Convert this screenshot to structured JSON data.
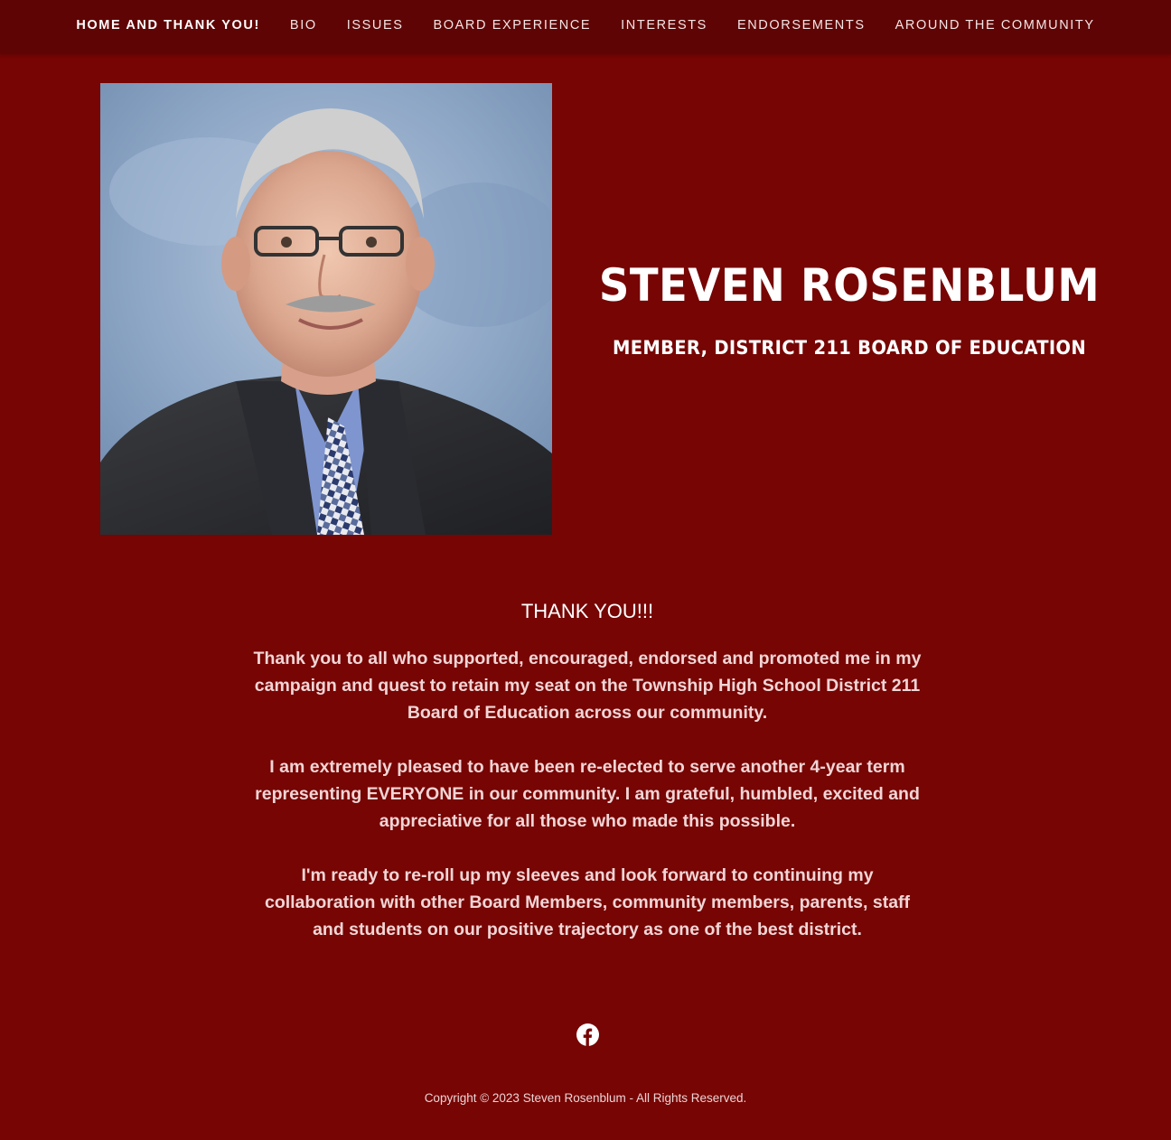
{
  "nav": {
    "items": [
      {
        "label": "HOME AND THANK YOU!"
      },
      {
        "label": "BIO"
      },
      {
        "label": "ISSUES"
      },
      {
        "label": "BOARD EXPERIENCE"
      },
      {
        "label": "INTERESTS"
      },
      {
        "label": "ENDORSEMENTS"
      },
      {
        "label": "AROUND THE COMMUNITY"
      }
    ],
    "active_index": 0
  },
  "hero": {
    "name": "STEVEN ROSENBLUM",
    "title": "MEMBER, DISTRICT 211 BOARD OF EDUCATION",
    "photo_alt": "Portrait of Steven Rosenblum"
  },
  "content": {
    "heading": "THANK YOU!!!",
    "paragraphs": [
      "Thank you to all who supported, encouraged, endorsed and promoted me in my campaign and quest to retain my seat on the Township High School District 211 Board of Education across our community.",
      "I am extremely pleased to have been re-elected to serve another 4-year term representing EVERYONE in our community. I am grateful, humbled, excited and appreciative for all those who made this possible.",
      "I'm ready to re-roll up my sleeves and look forward to continuing my collaboration with other Board Members, community members, parents, staff and students on our positive trajectory as one of the best district."
    ]
  },
  "social": {
    "icon": "facebook-icon"
  },
  "footer": {
    "copyright": "Copyright © 2023 Steven Rosenblum - All Rights Reserved."
  },
  "colors": {
    "background": "#760504",
    "nav_background": "#5f0404",
    "text": "#ffffff"
  }
}
